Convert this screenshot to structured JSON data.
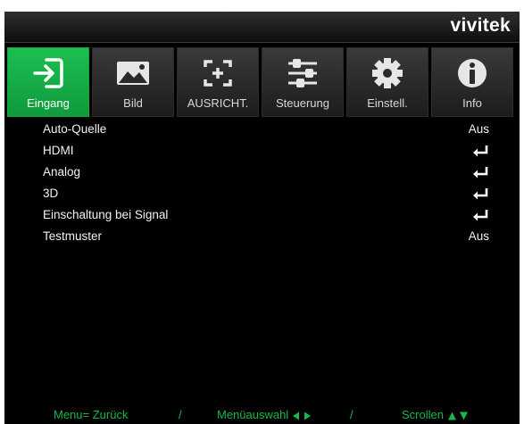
{
  "brand": "vivitek",
  "tabs": [
    {
      "label": "Eingang",
      "icon": "input-icon",
      "active": true
    },
    {
      "label": "Bild",
      "icon": "image-icon",
      "active": false
    },
    {
      "label": "AUSRICHT.",
      "icon": "alignment-icon",
      "active": false
    },
    {
      "label": "Steuerung",
      "icon": "sliders-icon",
      "active": false
    },
    {
      "label": "Einstell.",
      "icon": "gear-icon",
      "active": false
    },
    {
      "label": "Info",
      "icon": "info-icon",
      "active": false
    }
  ],
  "menu": [
    {
      "label": "Auto-Quelle",
      "value": "Aus"
    },
    {
      "label": "HDMI",
      "value": null,
      "icon": "enter-icon"
    },
    {
      "label": "Analog",
      "value": null,
      "icon": "enter-icon"
    },
    {
      "label": "3D",
      "value": null,
      "icon": "enter-icon"
    },
    {
      "label": "Einschaltung bei Signal",
      "value": null,
      "icon": "enter-icon"
    },
    {
      "label": "Testmuster",
      "value": "Aus"
    }
  ],
  "footer": {
    "back": "Menu= Zurück",
    "sep1": "/",
    "select": "Menüauswahl",
    "sep2": "/",
    "scroll": "Scrollen"
  },
  "colors": {
    "accent": "#12a640",
    "footer_text": "#18b84a",
    "background": "#000000"
  }
}
